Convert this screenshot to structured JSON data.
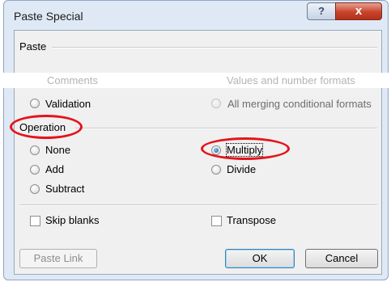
{
  "dialog": {
    "title": "Paste Special",
    "help_label": "?",
    "close_label": "x"
  },
  "paste_section": {
    "label": "Paste",
    "faded_left": "Comments",
    "faded_right": "Values and number formats",
    "validation_label": "Validation",
    "all_merging_label": "All merging conditional formats"
  },
  "operation": {
    "label": "Operation",
    "none_label": "None",
    "add_label": "Add",
    "subtract_label": "Subtract",
    "multiply_label": "Multiply",
    "divide_label": "Divide",
    "selected": "Multiply"
  },
  "options": {
    "skip_blanks_label": "Skip blanks",
    "transpose_label": "Transpose"
  },
  "buttons": {
    "paste_link": "Paste Link",
    "ok": "OK",
    "cancel": "Cancel"
  },
  "colors": {
    "highlight": "#e4141b",
    "title_bar": "#dfe9f5",
    "close_button": "#c7432a"
  }
}
